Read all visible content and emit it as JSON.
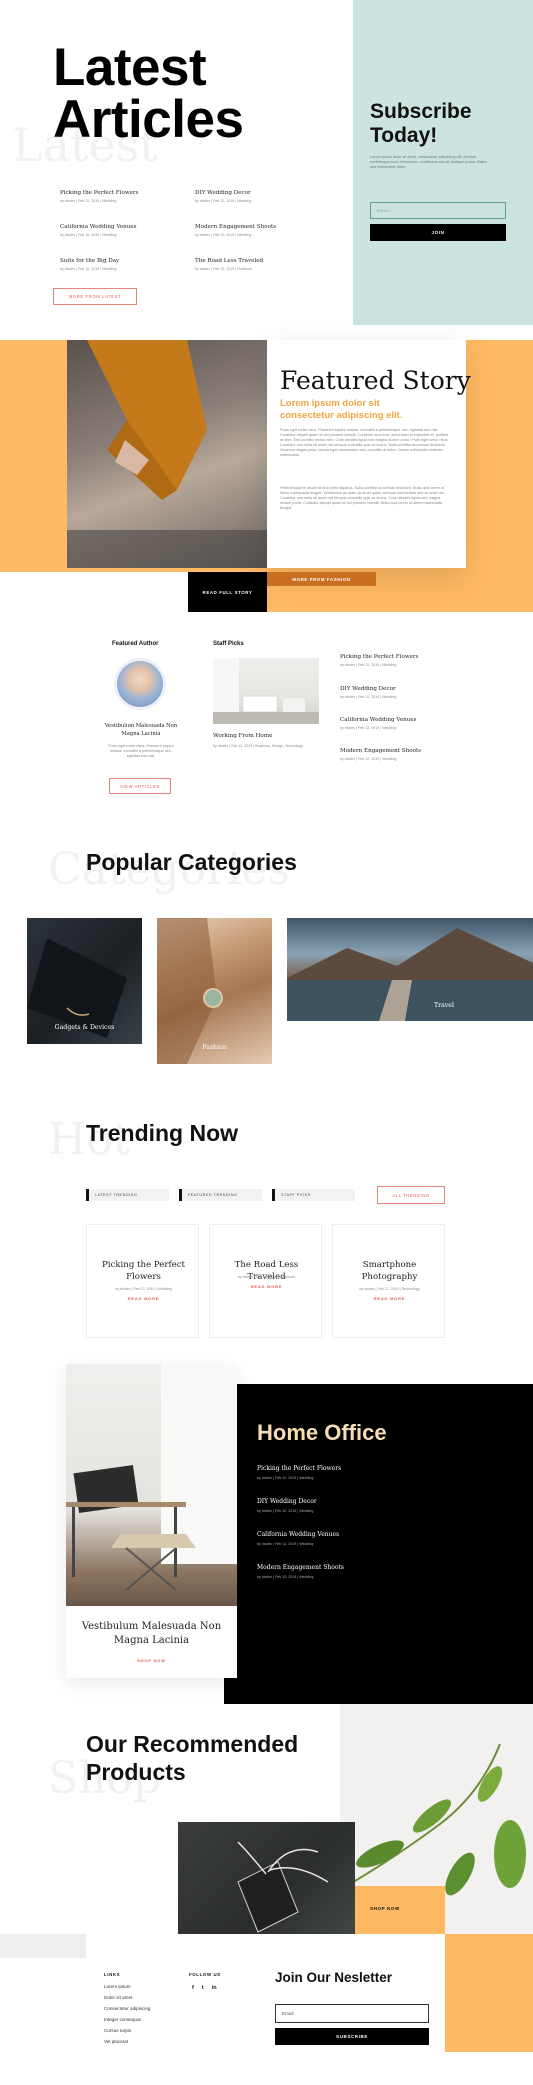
{
  "latest": {
    "ghost_word": "Latest",
    "title_line1": "Latest",
    "title_line2": "Articles",
    "articles": [
      {
        "title": "Picking the Perfect Flowers",
        "meta": "by divdev | Feb 12, 2019 | Wedding"
      },
      {
        "title": "DIY Wedding Decor",
        "meta": "by divdev | Feb 12, 2019 | Wedding"
      },
      {
        "title": "California Wedding Venues",
        "meta": "by divdev | Feb 12, 2019 | Wedding"
      },
      {
        "title": "Modern Engagement Shoots",
        "meta": "by divdev | Feb 12, 2019 | Wedding"
      },
      {
        "title": "Suits for the Big Day",
        "meta": "by divdev | Feb 12, 2019 | Wedding"
      },
      {
        "title": "The Road Less Traveled",
        "meta": "by divdev | Feb 12, 2019 | Outdoors"
      }
    ],
    "more_button": "MORE FROM LATEST"
  },
  "subscribe": {
    "title_line1": "Subscribe",
    "title_line2": "Today!",
    "body": "Lorem ipsum dolor sit amet, consectetur adipiscing elit. Aenean scelerisque nunc fermentum, vestibulum nisi at, tristique purus. Etiam sed elementum dolor.",
    "email_placeholder": "EMAIL",
    "join_label": "JOIN"
  },
  "featured": {
    "title": "Featured Story",
    "subtitle": "Lorem ipsum dolor sit consectetur adipiscing elit.",
    "para1": "Proin eget tortor risus. Praesent sapien massa, convallis a pellentesque nec, egestas non nisi. Curabitur aliquet quam id dui posuere blandit. Curabitur arcu erat, accumsan id imperdiet et, porttitor at sem. Sed porttitor lectus nibh. Cras ultricies ligula sed magna dictum porta. Proin eget tortor risus. Curabitur non nulla sit amet nisl tempus convallis quis ac lectus. Nulla porttitor accumsan tincidunt. Vivamus magna justo, lacinia eget consectetur sed, convallis at tellus. Donec sollicitudin molestie malesuada.",
    "para2": "Pellentesque in ipsum id orci porta dapibus. Nulla porttitor accumsan tincidunt. Nulla quis lorem ut libero malesuada feugiat. Vestibulum ac diam sit amet quam vehicula elementum sed sit amet dui. Curabitur non nulla sit amet nisl tempus convallis quis ac lectus. Cras ultricies ligula sed magna dictum porta. Curabitur aliquet quam id dui posuere blandit. Nulla quis lorem ut libero malesuada feugiat.",
    "read_button": "READ FULL STORY",
    "more_button": "MORE FROM FASHION"
  },
  "author": {
    "heading": "Featured Author",
    "name": "Vestibulum Malesuada Non Magna Lacinia",
    "bio": "Proin eget tortor risus. Praesent sapien massa, convallis a pellentesque nec, egestas non nisi.",
    "button": "VIEW ARTICLES"
  },
  "staff": {
    "heading": "Staff Picks",
    "main_title": "Working From Home",
    "main_meta": "by divdev | Feb 12, 2019 | Business, Design, Technology",
    "items": [
      {
        "title": "Picking the Perfect Flowers",
        "meta": "by divdev | Feb 12, 2019 | Wedding"
      },
      {
        "title": "DIY Wedding Decor",
        "meta": "by divdev | Feb 12, 2019 | Wedding"
      },
      {
        "title": "California Wedding Venues",
        "meta": "by divdev | Feb 12, 2019 | Wedding"
      },
      {
        "title": "Modern Engagement Shoots",
        "meta": "by divdev | Feb 12, 2019 | Wedding"
      }
    ]
  },
  "categories": {
    "ghost_word": "Categories",
    "title": "Popular Categories",
    "items": [
      "Gadgets & Devices",
      "Fashion",
      "Travel"
    ]
  },
  "trending": {
    "ghost_word": "Hot",
    "title": "Trending Now",
    "tabs": [
      "LATEST TRENDING",
      "FEATURED TRENDING",
      "STAFF PICKS"
    ],
    "all_button": "ALL TRENDING",
    "cards": [
      {
        "title": "Picking the Perfect Flowers",
        "meta": "by divdev | Feb 12, 2019 | Wedding",
        "link": "READ MORE"
      },
      {
        "title": "The Road Less Traveled",
        "meta": "by divdev | Feb 12, 2019 | Outdoors",
        "link": "READ MORE"
      },
      {
        "title": "Smartphone Photography",
        "meta": "by divdev | Feb 12, 2019 | Technology",
        "link": "READ MORE"
      }
    ]
  },
  "home_office": {
    "title": "Home Office",
    "product_name": "Vestibulum Malesuada Non Magna Lacinia",
    "shop_link": "SHOP NOW",
    "items": [
      {
        "title": "Picking the Perfect Flowers",
        "meta": "by divdev | Feb 12, 2019 | Wedding"
      },
      {
        "title": "DIY Wedding Decor",
        "meta": "by divdev | Feb 12, 2019 | Wedding"
      },
      {
        "title": "California Wedding Venues",
        "meta": "by divdev | Feb 12, 2019 | Wedding"
      },
      {
        "title": "Modern Engagement Shoots",
        "meta": "by divdev | Feb 12, 2019 | Wedding"
      }
    ]
  },
  "recommended": {
    "ghost_word": "Shop",
    "title_line1": "Our Recommended",
    "title_line2": "Products",
    "shop_button": "SHOP NOW"
  },
  "footer": {
    "links_heading": "LINKS",
    "links": [
      "Lorem ipsum",
      "Dolor sit amet",
      "Consectetur adipiscing",
      "Integer consequat",
      "Cursus turpis",
      "Vel placerat"
    ],
    "follow_heading": "FOLLOW US",
    "social_icons": [
      "f",
      "t",
      "in"
    ],
    "newsletter_title": "Join Our Nesletter",
    "email_placeholder": "Email",
    "subscribe_label": "SUBSCRIBE"
  },
  "colors": {
    "mint": "#cde3df",
    "orange": "#ffb963",
    "accent_orange": "#f4a540",
    "coral": "#e05a4f",
    "cream": "#f7dcb4",
    "black": "#000000"
  }
}
